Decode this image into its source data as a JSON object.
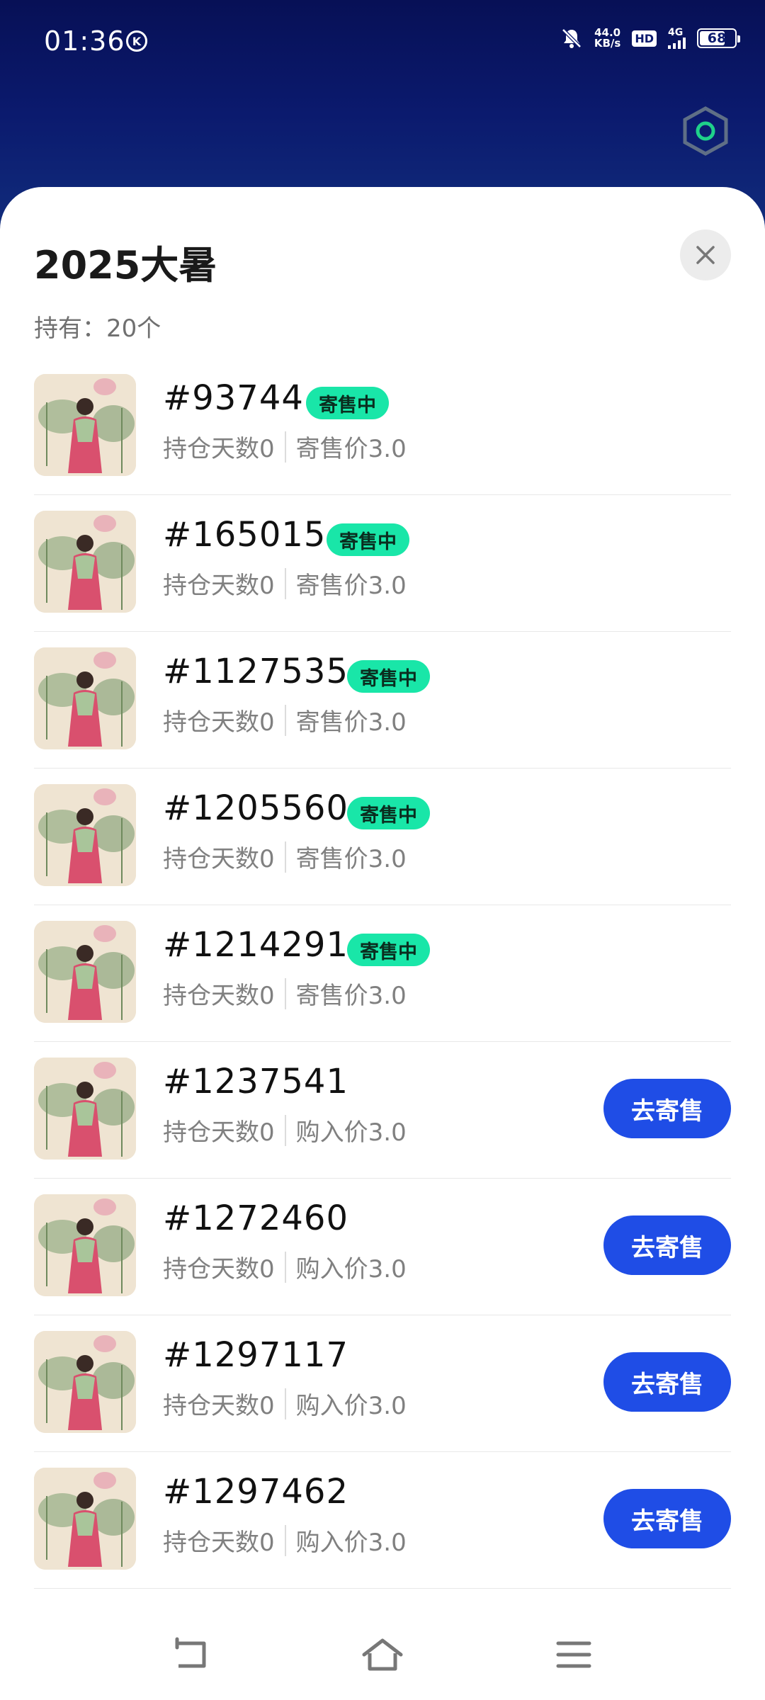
{
  "status_bar": {
    "time": "01:36",
    "k_badge": "K",
    "speed_value": "44.0",
    "speed_unit": "KB/s",
    "hd": "HD",
    "network": "4G",
    "battery": "68"
  },
  "panel": {
    "title": "2025大暑",
    "hold_label": "持有：20个"
  },
  "items": [
    {
      "code": "#93744",
      "days": "持仓天数0",
      "price": "寄售价3.0",
      "badge": "寄售中"
    },
    {
      "code": "#165015",
      "days": "持仓天数0",
      "price": "寄售价3.0",
      "badge": "寄售中"
    },
    {
      "code": "#1127535",
      "days": "持仓天数0",
      "price": "寄售价3.0",
      "badge": "寄售中"
    },
    {
      "code": "#1205560",
      "days": "持仓天数0",
      "price": "寄售价3.0",
      "badge": "寄售中"
    },
    {
      "code": "#1214291",
      "days": "持仓天数0",
      "price": "寄售价3.0",
      "badge": "寄售中"
    },
    {
      "code": "#1237541",
      "days": "持仓天数0",
      "price": "购入价3.0",
      "button": "去寄售"
    },
    {
      "code": "#1272460",
      "days": "持仓天数0",
      "price": "购入价3.0",
      "button": "去寄售"
    },
    {
      "code": "#1297117",
      "days": "持仓天数0",
      "price": "购入价3.0",
      "button": "去寄售"
    },
    {
      "code": "#1297462",
      "days": "持仓天数0",
      "price": "购入价3.0",
      "button": "去寄售"
    }
  ],
  "colors": {
    "badge_bg": "#19e6a8",
    "button_bg": "#1f4de6",
    "header_bg": "#0b1a6e"
  },
  "icons": [
    "mute-icon",
    "hexagon-icon",
    "close-icon",
    "back-icon",
    "home-icon",
    "menu-icon"
  ]
}
